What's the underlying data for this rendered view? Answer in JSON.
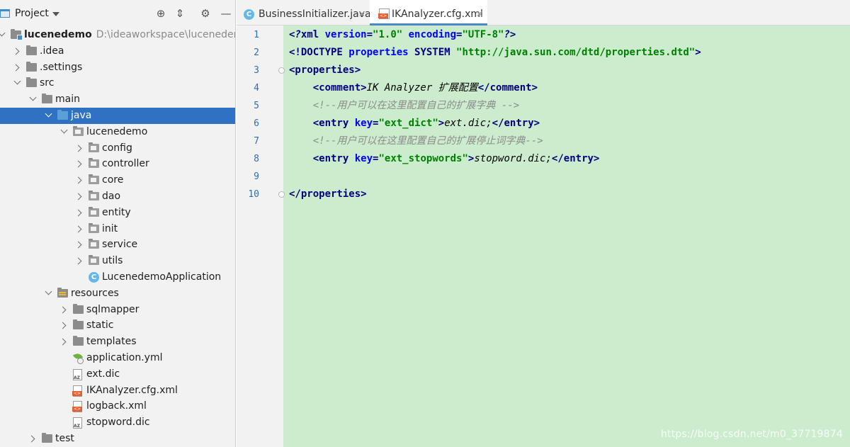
{
  "project_panel": {
    "title": "Project",
    "tree": [
      {
        "label": "lucenedemo",
        "path": "D:\\ideaworkspace\\lucenedemo",
        "depth": 0,
        "state": "expanded",
        "icon": "module-folder-icon",
        "bold": true
      },
      {
        "label": ".idea",
        "depth": 1,
        "state": "collapsed",
        "icon": "folder-icon"
      },
      {
        "label": ".settings",
        "depth": 1,
        "state": "collapsed",
        "icon": "folder-icon"
      },
      {
        "label": "src",
        "depth": 1,
        "state": "expanded",
        "icon": "folder-icon"
      },
      {
        "label": "main",
        "depth": 2,
        "state": "expanded",
        "icon": "folder-icon"
      },
      {
        "label": "java",
        "depth": 3,
        "state": "expanded",
        "icon": "source-folder-icon",
        "selected": true
      },
      {
        "label": "lucenedemo",
        "depth": 4,
        "state": "expanded",
        "icon": "package-icon"
      },
      {
        "label": "config",
        "depth": 5,
        "state": "collapsed",
        "icon": "package-icon"
      },
      {
        "label": "controller",
        "depth": 5,
        "state": "collapsed",
        "icon": "package-icon"
      },
      {
        "label": "core",
        "depth": 5,
        "state": "collapsed",
        "icon": "package-icon"
      },
      {
        "label": "dao",
        "depth": 5,
        "state": "collapsed",
        "icon": "package-icon"
      },
      {
        "label": "entity",
        "depth": 5,
        "state": "collapsed",
        "icon": "package-icon"
      },
      {
        "label": "init",
        "depth": 5,
        "state": "collapsed",
        "icon": "package-icon"
      },
      {
        "label": "service",
        "depth": 5,
        "state": "collapsed",
        "icon": "package-icon"
      },
      {
        "label": "utils",
        "depth": 5,
        "state": "collapsed",
        "icon": "package-icon"
      },
      {
        "label": "LucenedemoApplication",
        "depth": 5,
        "state": "leaf",
        "icon": "spring-class-icon"
      },
      {
        "label": "resources",
        "depth": 3,
        "state": "expanded",
        "icon": "resources-folder-icon"
      },
      {
        "label": "sqlmapper",
        "depth": 4,
        "state": "collapsed",
        "icon": "folder-icon"
      },
      {
        "label": "static",
        "depth": 4,
        "state": "collapsed",
        "icon": "folder-icon"
      },
      {
        "label": "templates",
        "depth": 4,
        "state": "collapsed",
        "icon": "folder-icon"
      },
      {
        "label": "application.yml",
        "depth": 4,
        "state": "leaf",
        "icon": "spring-yml-icon"
      },
      {
        "label": "ext.dic",
        "depth": 4,
        "state": "leaf",
        "icon": "dic-file-icon"
      },
      {
        "label": "IKAnalyzer.cfg.xml",
        "depth": 4,
        "state": "leaf",
        "icon": "xml-file-icon"
      },
      {
        "label": "logback.xml",
        "depth": 4,
        "state": "leaf",
        "icon": "xml-file-icon"
      },
      {
        "label": "stopword.dic",
        "depth": 4,
        "state": "leaf",
        "icon": "dic-file-icon"
      },
      {
        "label": "test",
        "depth": 2,
        "state": "collapsed",
        "icon": "folder-icon"
      }
    ]
  },
  "tabs": [
    {
      "label": "BusinessInitializer.java",
      "icon": "java-class-icon",
      "active": false
    },
    {
      "label": "IKAnalyzer.cfg.xml",
      "icon": "xml-file-icon",
      "active": true
    }
  ],
  "editor": {
    "lines": [
      {
        "n": "1",
        "tokens": [
          [
            "pi",
            "<?"
          ],
          [
            "tag",
            "xml "
          ],
          [
            "attr",
            "version"
          ],
          [
            "tag",
            "="
          ],
          [
            "val",
            "\"1.0\" "
          ],
          [
            "attr",
            "encoding"
          ],
          [
            "tag",
            "="
          ],
          [
            "val",
            "\"UTF-8\""
          ],
          [
            "pi",
            "?>"
          ]
        ]
      },
      {
        "n": "2",
        "tokens": [
          [
            "tag",
            "<!DOCTYPE "
          ],
          [
            "attr",
            "properties "
          ],
          [
            "tag",
            "SYSTEM "
          ],
          [
            "val",
            "\"http://java.sun.com/dtd/properties.dtd\""
          ],
          [
            "tag",
            ">"
          ]
        ]
      },
      {
        "n": "3",
        "tokens": [
          [
            "tag",
            "<properties>"
          ]
        ]
      },
      {
        "n": "4",
        "tokens": [
          [
            "plain",
            "    "
          ],
          [
            "tag",
            "<comment>"
          ],
          [
            "text",
            "IK Analyzer 扩展配置"
          ],
          [
            "tag",
            "</comment>"
          ]
        ]
      },
      {
        "n": "5",
        "tokens": [
          [
            "plain",
            "    "
          ],
          [
            "comment",
            "<!--用户可以在这里配置自己的扩展字典 -->"
          ]
        ]
      },
      {
        "n": "6",
        "tokens": [
          [
            "plain",
            "    "
          ],
          [
            "tag",
            "<entry "
          ],
          [
            "attr",
            "key"
          ],
          [
            "tag",
            "="
          ],
          [
            "val",
            "\"ext_dict\""
          ],
          [
            "tag",
            ">"
          ],
          [
            "text",
            "ext.dic;"
          ],
          [
            "tag",
            "</entry>"
          ]
        ]
      },
      {
        "n": "7",
        "tokens": [
          [
            "plain",
            "    "
          ],
          [
            "comment",
            "<!--用户可以在这里配置自己的扩展停止词字典-->"
          ]
        ]
      },
      {
        "n": "8",
        "tokens": [
          [
            "plain",
            "    "
          ],
          [
            "tag",
            "<entry "
          ],
          [
            "attr",
            "key"
          ],
          [
            "tag",
            "="
          ],
          [
            "val",
            "\"ext_stopwords\""
          ],
          [
            "tag",
            ">"
          ],
          [
            "text",
            "stopword.dic;"
          ],
          [
            "tag",
            "</entry>"
          ]
        ]
      },
      {
        "n": "9",
        "tokens": []
      },
      {
        "n": "10",
        "tokens": [
          [
            "tag",
            "</properties>"
          ]
        ]
      }
    ],
    "fold_lines": [
      "3",
      "10"
    ]
  },
  "watermark": "https://blog.csdn.net/m0_37719874",
  "colors": {
    "selection": "#2f72c4",
    "code_background": "#cbeccd",
    "line_number": "#2f6fb1"
  }
}
